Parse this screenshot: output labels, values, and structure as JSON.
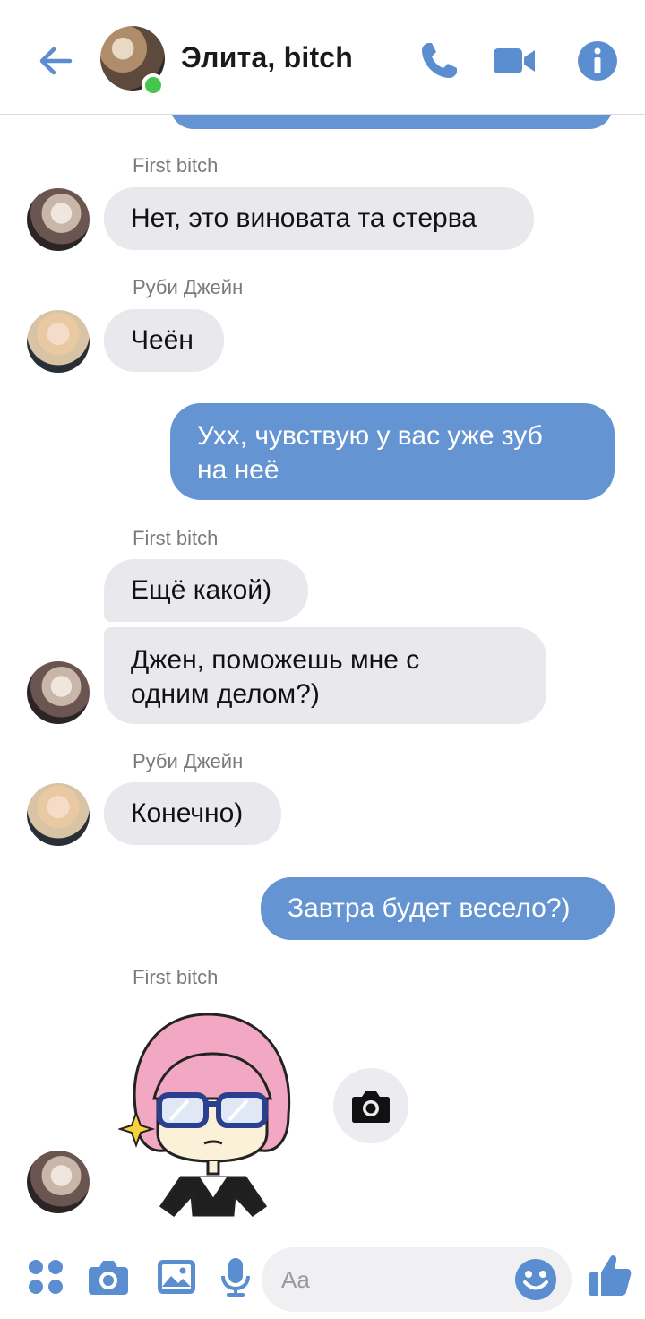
{
  "header": {
    "title": "Элита, bitch"
  },
  "messages": [
    {
      "sender": "First bitch",
      "bubbles": [
        "Нет, это виновата та стерва"
      ]
    },
    {
      "sender": "Руби Джейн",
      "bubbles": [
        "Чеён"
      ]
    },
    {
      "outgoing": [
        "Ухх, чувствую у вас уже зуб",
        "на неё"
      ]
    },
    {
      "sender": "First bitch",
      "bubbles": [
        "Ещё какой)",
        "Джен, поможешь мне с",
        "одним делом?)"
      ]
    },
    {
      "sender": "Руби Джейн",
      "bubbles": [
        "Конечно)"
      ]
    },
    {
      "outgoing": [
        "Завтра будет весело?)"
      ]
    },
    {
      "sender": "First bitch"
    }
  ],
  "composer": {
    "placeholder": "Aa"
  },
  "colors": {
    "accent": "#6495d2",
    "incoming_bubble": "#e9e9ed",
    "online": "#44c74a"
  },
  "icons": [
    "back-arrow-icon",
    "phone-icon",
    "video-camera-icon",
    "info-icon",
    "apps-grid-icon",
    "camera-icon",
    "gallery-icon",
    "microphone-icon",
    "emoji-icon",
    "thumbs-up-icon"
  ]
}
